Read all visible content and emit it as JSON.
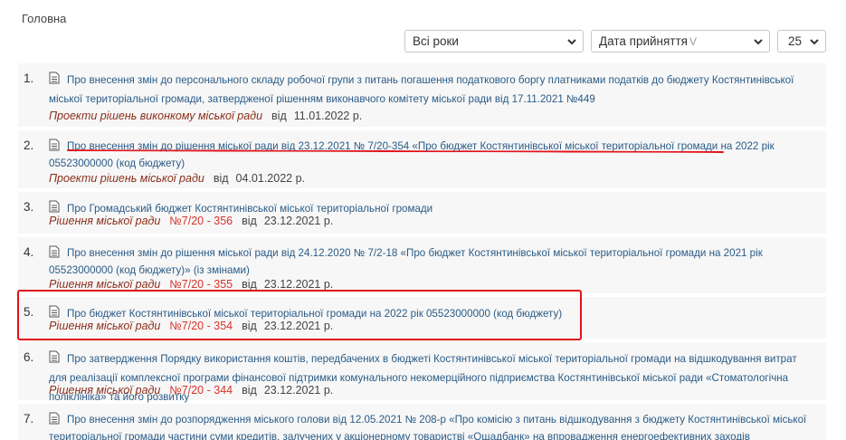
{
  "breadcrumb": "Головна",
  "filters": {
    "years": "Всі роки",
    "order": "Дата прийняття",
    "order_mark": "V",
    "per_page": "25"
  },
  "items": [
    {
      "num": "1.",
      "title": "Про внесення змін до персонального складу робочої групи з питань погашення податкового боргу платниками податків до бюджету Костянтинівської міської територіальної громади, затвердженої рішенням виконавчого комітету міської ради від 17.11.2021 №449",
      "type": "Проекти рішень виконкому міської ради",
      "rnum": "",
      "since": "від",
      "date": "11.01.2022 р."
    },
    {
      "num": "2.",
      "title": "Про внесення змін до рішення міської ради від 23.12.2021 № 7/20-354 «Про бюджет Костянтинівської міської територіальної громади на 2022 рік 05523000000 (код бюджету)",
      "type": "Проекти рішень міської ради",
      "rnum": "",
      "since": "від",
      "date": "04.01.2022 р."
    },
    {
      "num": "3.",
      "title": "Про Громадський бюджет Костянтинівської міської територіальної громади",
      "type": "Рішення міської ради",
      "rnum": "№7/20 - 356",
      "since": "від",
      "date": "23.12.2021 р."
    },
    {
      "num": "4.",
      "title": "Про внесення змін до рішення міської ради від 24.12.2020 № 7/2-18 «Про бюджет Костянтинівської міської територіальної громади на 2021 рік 05523000000 (код бюджету)» (із змінами)",
      "type": "Рішення міської ради",
      "rnum": "№7/20 - 355",
      "since": "від",
      "date": "23.12.2021 р."
    },
    {
      "num": "5.",
      "title": "Про бюджет Костянтинівської міської територіальної громади на 2022 рік 05523000000 (код бюджету)",
      "type": "Рішення міської ради",
      "rnum": "№7/20 - 354",
      "since": "від",
      "date": "23.12.2021 р."
    },
    {
      "num": "6.",
      "title": "Про затвердження Порядку використання коштів, передбачених в бюджеті Костянтинівської міської територіальної громади на відшкодування витрат для реалізації комплексної програми фінансової підтримки комунального некомерційного підприємства Костянтинівської міської ради «Стоматологічна поліклініка» та його розвитку",
      "type": "Рішення міської ради",
      "rnum": "№7/20 - 344",
      "since": "від",
      "date": "23.12.2021 р."
    },
    {
      "num": "7.",
      "title": "Про внесення змін до розпорядження міського голови від 12.05.2021 № 208-р «Про комісію з питань відшкодування з бюджету Костянтинівської міської територіальної громади частини суми кредитів, залучених у акціонерному товаристві «Ощадбанк» на впровадження енергоефективних заходів",
      "type": "",
      "rnum": "",
      "since": "",
      "date": ""
    }
  ]
}
